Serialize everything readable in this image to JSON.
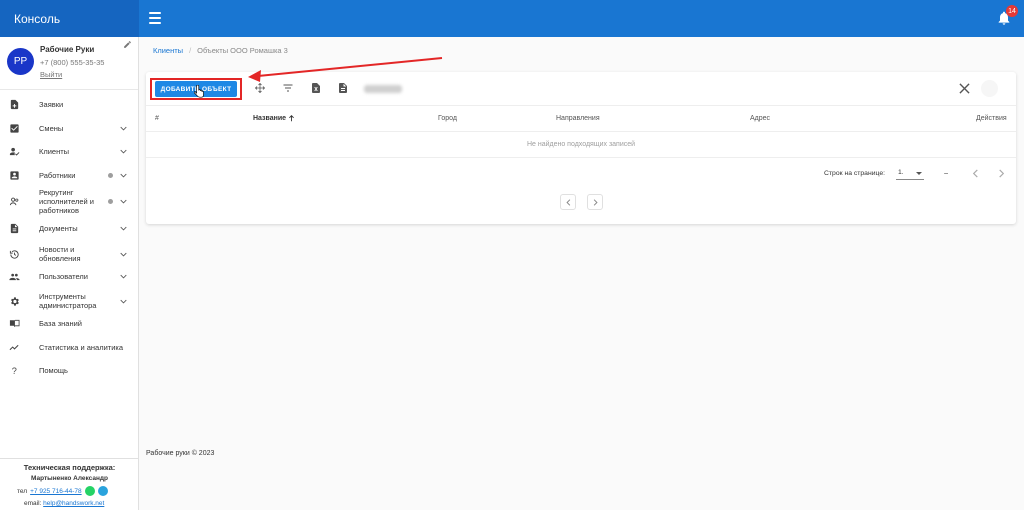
{
  "brand": {
    "title": "Консоль"
  },
  "header": {
    "notifications_count": "14"
  },
  "profile": {
    "initials": "РР",
    "name": "Рабочие Руки",
    "phone": "+7 (800) 555-35-35",
    "logout": "Выйти"
  },
  "sidebar": {
    "items": [
      {
        "label": "Заявки",
        "icon": "document-plus-icon"
      },
      {
        "label": "Смены",
        "icon": "checkbox-icon"
      },
      {
        "label": "Клиенты",
        "icon": "person-check-icon"
      },
      {
        "label": "Работники",
        "icon": "id-badge-icon"
      },
      {
        "label": "Рекрутинг исполнителей и работников",
        "icon": "people-search-icon"
      },
      {
        "label": "Документы",
        "icon": "file-icon"
      },
      {
        "label": "Новости и обновления",
        "icon": "history-icon"
      },
      {
        "label": "Пользователи",
        "icon": "group-icon"
      },
      {
        "label": "Инструменты администратора",
        "icon": "gear-icon"
      },
      {
        "label": "База знаний",
        "icon": "book-icon"
      },
      {
        "label": "Статистика и аналитика",
        "icon": "trending-icon"
      },
      {
        "label": "Помощь",
        "icon": "question-icon"
      }
    ]
  },
  "support": {
    "title": "Техническая поддержка:",
    "name": "Мартыненко Александр",
    "phone_prefix": "тел",
    "phone": "+7 925 716-44-78",
    "email_prefix": "email:",
    "email": "help@handswork.net"
  },
  "breadcrumb": {
    "parent": "Клиенты",
    "separator": "/",
    "current": "Объекты ООО Ромашка 3"
  },
  "toolbar": {
    "add_label": "ДОБАВИТЬ ОБЪЕКТ"
  },
  "table": {
    "columns": [
      "#",
      "Название",
      "Город",
      "Направления",
      "Адрес",
      "Действия"
    ],
    "empty_text": "Не найдено подходящих записей"
  },
  "pagination": {
    "rows_label": "Строк на странице:",
    "rows_value": "1.",
    "range": "–"
  },
  "footer": {
    "copyright": "Рабочие руки © 2023"
  },
  "colors": {
    "primary": "#1976d2",
    "brand": "#1565c0",
    "highlight": "#e32626",
    "badge": "#e53935"
  }
}
